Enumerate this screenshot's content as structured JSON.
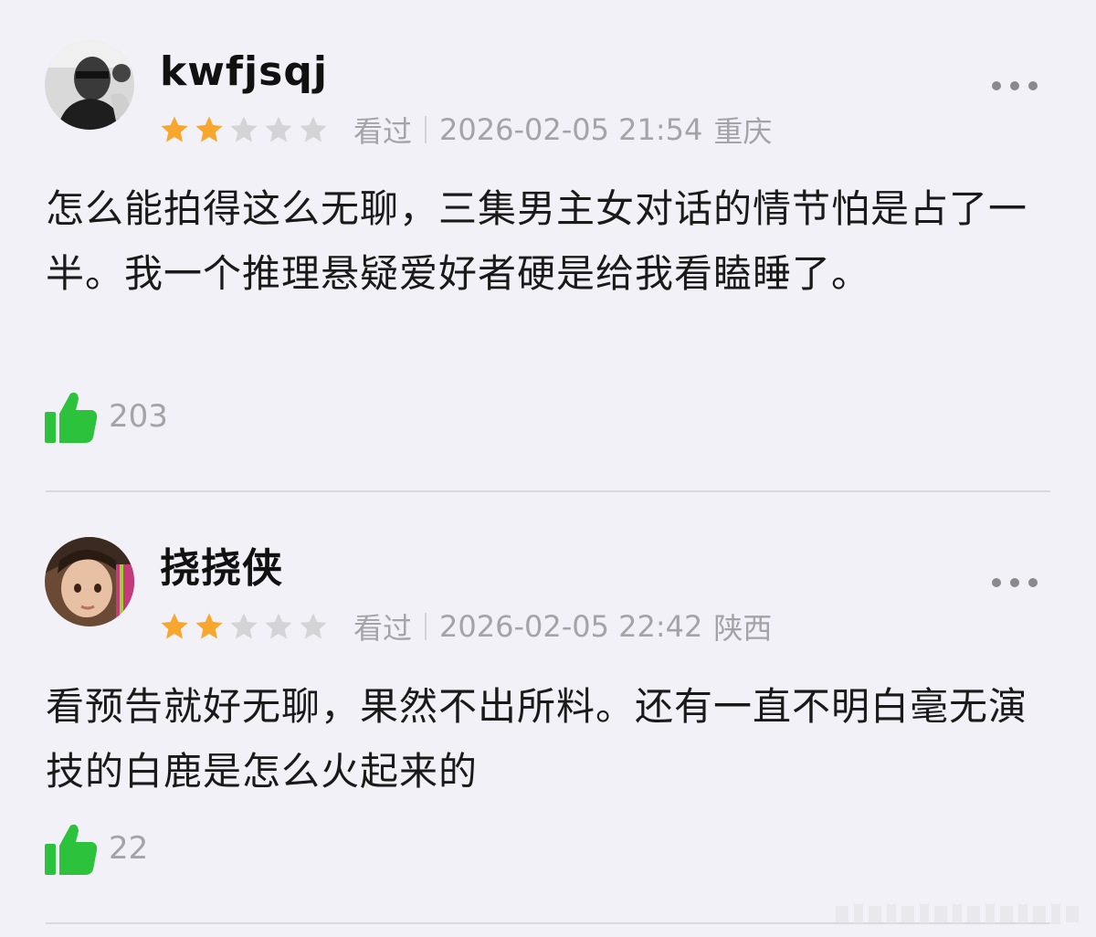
{
  "reviews": [
    {
      "username": "kwfjsqj",
      "rating": 2,
      "rating_max": 5,
      "status": "看过",
      "datetime": "2026-02-05 21:54",
      "location": "重庆",
      "content": "怎么能拍得这么无聊，三集男主女对话的情节怕是占了一半。我一个推理悬疑爱好者硬是给我看瞌睡了。",
      "likes": "203"
    },
    {
      "username": "挠挠侠",
      "rating": 2,
      "rating_max": 5,
      "status": "看过",
      "datetime": "2026-02-05 22:42",
      "location": "陕西",
      "content": "看预告就好无聊，果然不出所料。还有一直不明白毫无演技的白鹿是怎么火起来的",
      "likes": "22"
    }
  ],
  "icons": {
    "star_filled": "star-icon",
    "star_empty": "star-outline-icon",
    "like": "thumbs-up-icon",
    "more": "more-dots-icon"
  },
  "colors": {
    "background": "#f2f1f7",
    "star_filled": "#f7a72e",
    "star_empty": "#d4d4d8",
    "thumb": "#2cc23c",
    "meta_text": "#a3a3a8"
  }
}
